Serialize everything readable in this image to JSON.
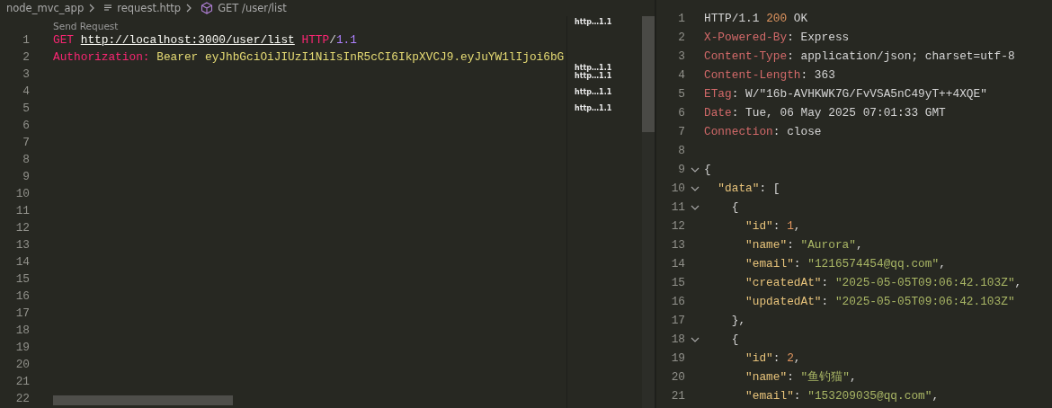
{
  "breadcrumb": {
    "folder": "node_mvc_app",
    "file": "request.http",
    "symbol": "GET /user/list"
  },
  "request_editor": {
    "codelens": "Send Request",
    "lines": [
      {
        "number": "1",
        "tokens": [
          {
            "text": "GET ",
            "kind": "method"
          },
          {
            "text": "http://localhost:3000/user/list",
            "kind": "url"
          },
          {
            "text": " HTTP",
            "kind": "method"
          },
          {
            "text": "/",
            "kind": "plain"
          },
          {
            "text": "1.1",
            "kind": "version"
          }
        ]
      },
      {
        "number": "2",
        "tokens": [
          {
            "text": "Authorization: ",
            "kind": "method"
          },
          {
            "text": "Bearer eyJhbGciOiJIUzI1NiIsInR5cCI6IkpXVCJ9.eyJuYW1lIjoi6bG",
            "kind": "value"
          }
        ]
      },
      {
        "number": "3"
      },
      {
        "number": "4"
      },
      {
        "number": "5"
      },
      {
        "number": "6"
      },
      {
        "number": "7"
      },
      {
        "number": "8"
      },
      {
        "number": "9"
      },
      {
        "number": "10"
      },
      {
        "number": "11"
      },
      {
        "number": "12"
      },
      {
        "number": "13"
      },
      {
        "number": "14"
      },
      {
        "number": "15"
      },
      {
        "number": "16"
      },
      {
        "number": "17"
      },
      {
        "number": "18"
      },
      {
        "number": "19"
      },
      {
        "number": "20"
      },
      {
        "number": "21"
      },
      {
        "number": "22"
      }
    ],
    "minimap_labels": [
      "http…1.1",
      "http…1.1",
      "http…1.1",
      "http…1.1",
      "http…1.1"
    ]
  },
  "response_editor": {
    "lines": [
      {
        "number": "1",
        "fold_caret": false,
        "tokens": [
          {
            "text": "HTTP/1.1 ",
            "kind": "plain"
          },
          {
            "text": "200",
            "kind": "number"
          },
          {
            "text": " OK",
            "kind": "plain"
          }
        ]
      },
      {
        "number": "2",
        "fold_caret": false,
        "tokens": [
          {
            "text": "X-Powered-By",
            "kind": "header"
          },
          {
            "text": ": Express",
            "kind": "plain"
          }
        ]
      },
      {
        "number": "3",
        "fold_caret": false,
        "tokens": [
          {
            "text": "Content-Type",
            "kind": "header"
          },
          {
            "text": ": application/json; charset=utf-8",
            "kind": "plain"
          }
        ]
      },
      {
        "number": "4",
        "fold_caret": false,
        "tokens": [
          {
            "text": "Content-Length",
            "kind": "header"
          },
          {
            "text": ": 363",
            "kind": "plain"
          }
        ]
      },
      {
        "number": "5",
        "fold_caret": false,
        "tokens": [
          {
            "text": "ETag",
            "kind": "header"
          },
          {
            "text": ": W/\"16b-AVHKWK7G/FvVSA5nC49yT++4XQE\"",
            "kind": "plain"
          }
        ]
      },
      {
        "number": "6",
        "fold_caret": false,
        "tokens": [
          {
            "text": "Date",
            "kind": "header"
          },
          {
            "text": ": Tue, 06 May 2025 07:01:33 GMT",
            "kind": "plain"
          }
        ]
      },
      {
        "number": "7",
        "fold_caret": false,
        "tokens": [
          {
            "text": "Connection",
            "kind": "header"
          },
          {
            "text": ": close",
            "kind": "plain"
          }
        ]
      },
      {
        "number": "8",
        "fold_caret": false
      },
      {
        "number": "9",
        "fold_caret": true,
        "tokens": [
          {
            "text": "{",
            "kind": "plain"
          }
        ]
      },
      {
        "number": "10",
        "fold_caret": true,
        "tokens": [
          {
            "text": "  \"data\"",
            "kind": "key"
          },
          {
            "text": ": [",
            "kind": "plain"
          }
        ]
      },
      {
        "number": "11",
        "fold_caret": true,
        "tokens": [
          {
            "text": "    {",
            "kind": "plain"
          }
        ]
      },
      {
        "number": "12",
        "fold_caret": false,
        "tokens": [
          {
            "text": "      \"id\"",
            "kind": "key"
          },
          {
            "text": ": ",
            "kind": "plain"
          },
          {
            "text": "1",
            "kind": "number"
          },
          {
            "text": ",",
            "kind": "plain"
          }
        ]
      },
      {
        "number": "13",
        "fold_caret": false,
        "tokens": [
          {
            "text": "      \"name\"",
            "kind": "key"
          },
          {
            "text": ": ",
            "kind": "plain"
          },
          {
            "text": "\"Aurora\"",
            "kind": "string"
          },
          {
            "text": ",",
            "kind": "plain"
          }
        ]
      },
      {
        "number": "14",
        "fold_caret": false,
        "tokens": [
          {
            "text": "      \"email\"",
            "kind": "key"
          },
          {
            "text": ": ",
            "kind": "plain"
          },
          {
            "text": "\"1216574454@qq.com\"",
            "kind": "string"
          },
          {
            "text": ",",
            "kind": "plain"
          }
        ]
      },
      {
        "number": "15",
        "fold_caret": false,
        "tokens": [
          {
            "text": "      \"createdAt\"",
            "kind": "key"
          },
          {
            "text": ": ",
            "kind": "plain"
          },
          {
            "text": "\"2025-05-05T09:06:42.103Z\"",
            "kind": "string"
          },
          {
            "text": ",",
            "kind": "plain"
          }
        ]
      },
      {
        "number": "16",
        "fold_caret": false,
        "tokens": [
          {
            "text": "      \"updatedAt\"",
            "kind": "key"
          },
          {
            "text": ": ",
            "kind": "plain"
          },
          {
            "text": "\"2025-05-05T09:06:42.103Z\"",
            "kind": "string"
          }
        ]
      },
      {
        "number": "17",
        "fold_caret": false,
        "tokens": [
          {
            "text": "    },",
            "kind": "plain"
          }
        ]
      },
      {
        "number": "18",
        "fold_caret": true,
        "tokens": [
          {
            "text": "    {",
            "kind": "plain"
          }
        ]
      },
      {
        "number": "19",
        "fold_caret": false,
        "tokens": [
          {
            "text": "      \"id\"",
            "kind": "key"
          },
          {
            "text": ": ",
            "kind": "plain"
          },
          {
            "text": "2",
            "kind": "number"
          },
          {
            "text": ",",
            "kind": "plain"
          }
        ]
      },
      {
        "number": "20",
        "fold_caret": false,
        "tokens": [
          {
            "text": "      \"name\"",
            "kind": "key"
          },
          {
            "text": ": ",
            "kind": "plain"
          },
          {
            "text": "\"鱼钓猫\"",
            "kind": "string"
          },
          {
            "text": ",",
            "kind": "plain"
          }
        ]
      },
      {
        "number": "21",
        "fold_caret": false,
        "tokens": [
          {
            "text": "      \"email\"",
            "kind": "key"
          },
          {
            "text": ": ",
            "kind": "plain"
          },
          {
            "text": "\"153209035@qq.com\"",
            "kind": "string"
          },
          {
            "text": ",",
            "kind": "plain"
          }
        ]
      }
    ]
  }
}
